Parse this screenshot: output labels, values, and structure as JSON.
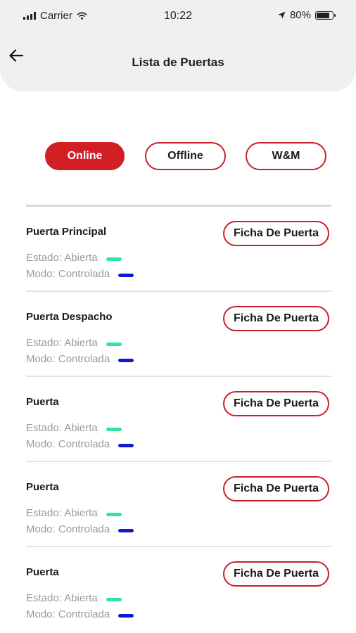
{
  "status_bar": {
    "carrier": "Carrier",
    "time": "10:22",
    "battery": "80%",
    "battery_level": 0.8
  },
  "header": {
    "title": "Lista de Puertas"
  },
  "filters": [
    {
      "label": "Online",
      "active": true
    },
    {
      "label": "Offline",
      "active": false
    },
    {
      "label": "W&M",
      "active": false
    }
  ],
  "colors": {
    "brand_red": "#d11f24",
    "estado_indicator": "#2ee6a0",
    "modo_indicator": "#1515d6"
  },
  "doors": [
    {
      "name": "Puerta Principal",
      "button": "Ficha De Puerta",
      "estado": "Estado: Abierta",
      "modo": "Modo: Controlada"
    },
    {
      "name": "Puerta Despacho",
      "button": "Ficha De Puerta",
      "estado": "Estado: Abierta",
      "modo": "Modo: Controlada"
    },
    {
      "name": "Puerta",
      "button": "Ficha De Puerta",
      "estado": "Estado: Abierta",
      "modo": "Modo: Controlada"
    },
    {
      "name": "Puerta",
      "button": "Ficha De Puerta",
      "estado": "Estado: Abierta",
      "modo": "Modo: Controlada"
    },
    {
      "name": "Puerta",
      "button": "Ficha De Puerta",
      "estado": "Estado: Abierta",
      "modo": "Modo: Controlada"
    }
  ]
}
